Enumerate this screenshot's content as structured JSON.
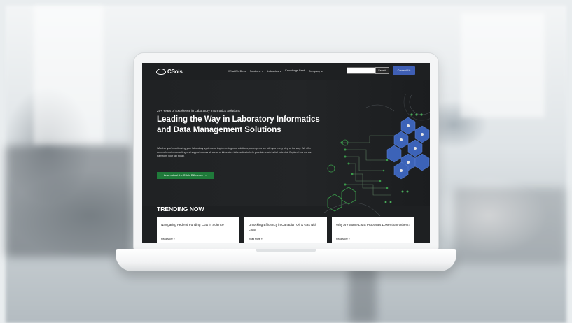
{
  "header": {
    "logo_text": "CSols",
    "nav": [
      "What We Do ⌄",
      "Solutions ⌄",
      "Industries ⌄",
      "Knowledge Bank",
      "Company ⌄"
    ],
    "search_placeholder": "",
    "search_button": "Search",
    "contact_button": "Contact Us"
  },
  "hero": {
    "eyebrow": "25+ Years of Excellence in Laboratory Informatics Solutions",
    "title": "Leading the Way in Laboratory Informatics and Data Management Solutions",
    "intro": "Whether you're optimizing your laboratory systems or implementing new solutions, our experts are with you every step of the way. We offer comprehensive consulting and support across all areas of laboratory informatics to help your lab reach its full potential. Explore how we can transform your lab today.",
    "cta": "Learn About the CSols Difference",
    "cta_arrow": "»"
  },
  "trending": {
    "title": "TRENDING NOW",
    "cards": [
      {
        "title": "Navigating Federal Funding Cuts in Science",
        "link": "Read More »"
      },
      {
        "title": "Unlocking Efficiency in Canadian Oil & Gas with LIMS",
        "link": "Read More »"
      },
      {
        "title": "Why Are Some LIMS Proposals Lower than Others?",
        "link": "Read More »"
      }
    ]
  },
  "colors": {
    "accent_blue": "#3f5fb5",
    "cta_green": "#1f7a3a",
    "hero_bg": "#202224",
    "graphic_green": "#3a9a4a",
    "graphic_blue": "#3c63b8"
  }
}
